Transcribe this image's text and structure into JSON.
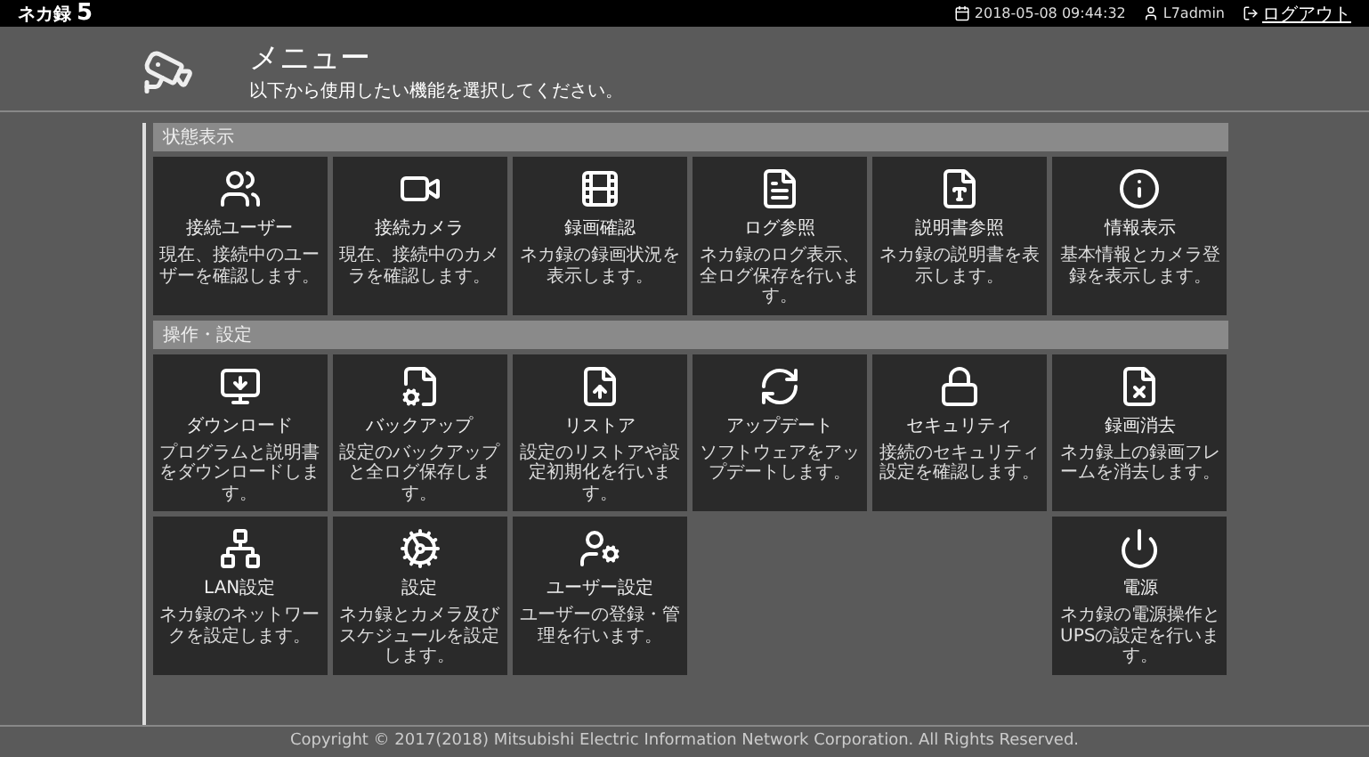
{
  "topbar": {
    "brand": "ネカ録",
    "version": "5",
    "datetime": "2018-05-08 09:44:32",
    "user": "L7admin",
    "logout": "ログアウト"
  },
  "header": {
    "title": "メニュー",
    "subtitle": "以下から使用したい機能を選択してください。"
  },
  "sections": [
    {
      "title": "状態表示",
      "tiles": [
        {
          "title": "接続ユーザー",
          "description": "現在、接続中のユーザーを確認します。",
          "kind": "tile"
        },
        {
          "title": "接続カメラ",
          "description": "現在、接続中のカメラを確認します。",
          "kind": "tile"
        },
        {
          "title": "録画確認",
          "description": "ネカ録の録画状況を表示します。",
          "kind": "tile"
        },
        {
          "title": "ログ参照",
          "description": "ネカ録のログ表示、全ログ保存を行います。",
          "kind": "tile"
        },
        {
          "title": "説明書参照",
          "description": "ネカ録の説明書を表示します。",
          "kind": "tile"
        },
        {
          "title": "情報表示",
          "description": "基本情報とカメラ登録を表示します。",
          "kind": "tile"
        }
      ]
    },
    {
      "title": "操作・設定",
      "tiles": [
        {
          "title": "ダウンロード",
          "description": "プログラムと説明書をダウンロードします。",
          "kind": "tile"
        },
        {
          "title": "バックアップ",
          "description": "設定のバックアップと全ログ保存します。",
          "kind": "tile"
        },
        {
          "title": "リストア",
          "description": "設定のリストアや設定初期化を行います。",
          "kind": "tile"
        },
        {
          "title": "アップデート",
          "description": "ソフトウェアをアップデートします。",
          "kind": "tile"
        },
        {
          "title": "セキュリティ",
          "description": "接続のセキュリティ設定を確認します。",
          "kind": "tile"
        },
        {
          "title": "録画消去",
          "description": "ネカ録上の録画フレームを消去します。",
          "kind": "tile"
        },
        {
          "title": "LAN設定",
          "description": "ネカ録のネットワークを設定します。",
          "kind": "tile"
        },
        {
          "title": "設定",
          "description": "ネカ録とカメラ及びスケジュールを設定します。",
          "kind": "tile"
        },
        {
          "title": "ユーザー設定",
          "description": "ユーザーの登録・管理を行います。",
          "kind": "tile"
        },
        {
          "title": "電源",
          "description": "ネカ録の電源操作とUPSの設定を行います。",
          "kind": "trailing"
        }
      ]
    }
  ],
  "footer": "Copyright © 2017(2018) Mitsubishi Electric Information Network Corporation. All Rights Reserved."
}
